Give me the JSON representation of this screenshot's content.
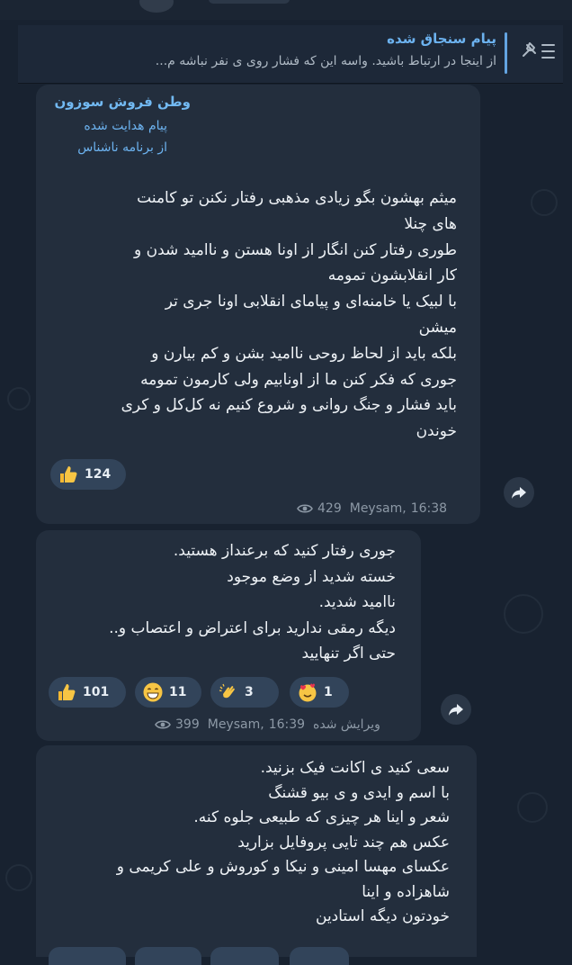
{
  "pinned": {
    "title": "پیام سنجاق شده",
    "text": "از اینجا در ارتباط باشید.  واسه این که فشار روی ی نفر نباشه  م..."
  },
  "messages": [
    {
      "sender": "وطن فروش سوزون",
      "forwarded_label": "پیام هدایت شده",
      "via_label": "از برنامه ناشناس",
      "lines": [
        "میثم بهشون بگو زیادی مذهبی رفتار نکنن تو کامنت",
        "های چنلا",
        "طوری رفتار کنن انگار از اونا هستن و ناامید شدن و",
        "کار انقلابشون تمومه",
        "با لبیک یا خامنه‌ای و پیامای انقلابی اونا جری تر",
        "میشن",
        "بلکه باید از لحاظ روحی ناامید بشن و کم بیارن و",
        "جوری که فکر کنن ما از اونابیم ولی کارمون تمومه",
        "باید فشار و جنگ روانی و شروع کنیم نه کل‌کل و کری",
        "خوندن"
      ],
      "reactions": [
        {
          "icon": "thumbs-up",
          "count": "124"
        }
      ],
      "views": "429",
      "author": "Meysam,",
      "time": "16:38"
    },
    {
      "lines": [
        "جوری رفتار کنید که برعنداز هستید.",
        "خسته شدید از وضع موجود",
        "ناامید شدید.",
        "دیگه رمقی ندارید برای اعتراض و اعتصاب و..",
        "حتی اگر تنهایید"
      ],
      "reactions": [
        {
          "icon": "thumbs-up",
          "count": "101"
        },
        {
          "icon": "grin",
          "count": "11"
        },
        {
          "icon": "clap",
          "count": "3"
        },
        {
          "icon": "hearts-face",
          "count": "1"
        }
      ],
      "edited_label": "ویرایش شده",
      "views": "399",
      "author": "Meysam,",
      "time": "16:39"
    },
    {
      "lines": [
        "سعی کنید ی اکانت فیک بزنید.",
        "با اسم و ایدی و ی بیو قشنگ",
        "شعر و اینا هر چیزی که طبیعی جلوه کنه.",
        "عکس هم چند تایی پروفایل بزارید",
        "عکسای مهسا امینی و نیکا و کوروش و علی کریمی و",
        "شاهزاده و اینا",
        "خودتون دیگه استادین"
      ]
    }
  ],
  "colors": {
    "background": "#182230",
    "bubble": "#232e3d",
    "accent": "#6cb2ef",
    "reaction_bg": "#32445a",
    "meta_text": "#8d99a6"
  },
  "icons": [
    "pin-list-icon",
    "thumbs-up-icon",
    "grin-icon",
    "clap-icon",
    "hearts-face-icon",
    "eye-icon",
    "share-arrow-icon"
  ]
}
